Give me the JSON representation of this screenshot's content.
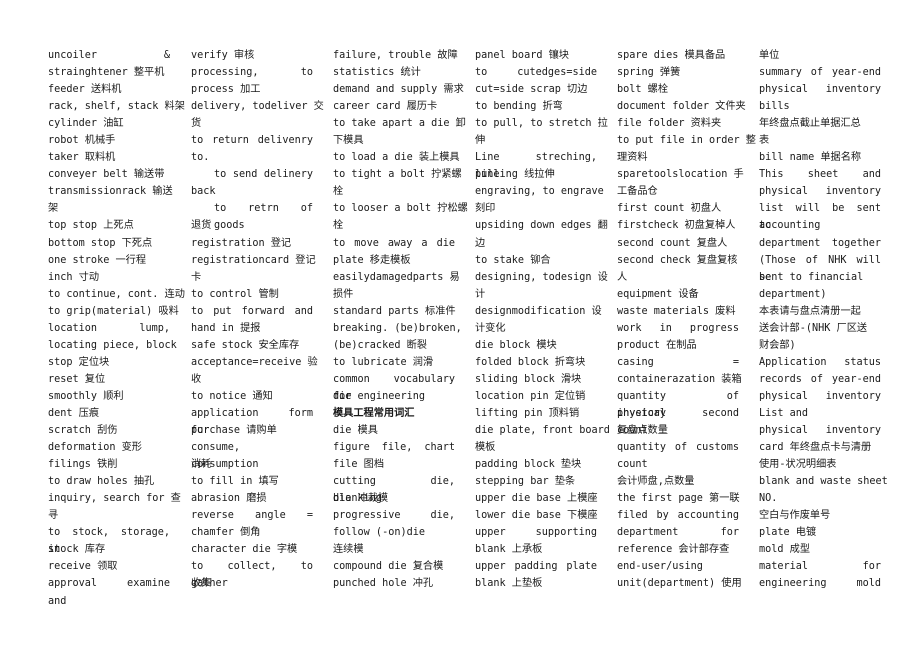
{
  "document": {
    "columns": [
      [
        {
          "t": "uncoiler &",
          "j": 1
        },
        {
          "t": "strainghtener 整平机"
        },
        {
          "t": "feeder 送料机"
        },
        {
          "t": "rack, shelf, stack 料架"
        },
        {
          "t": "cylinder 油缸"
        },
        {
          "t": "robot 机械手"
        },
        {
          "t": "taker 取料机"
        },
        {
          "t": "conveyer belt 输送带"
        },
        {
          "t": "transmissionrack 输送"
        },
        {
          "t": "架"
        },
        {
          "t": "top stop 上死点"
        },
        {
          "t": "bottom stop 下死点"
        },
        {
          "t": "one stroke 一行程"
        },
        {
          "t": "inch 寸动"
        },
        {
          "t": "to continue, cont. 连动"
        },
        {
          "t": "to grip(material) 吸料"
        },
        {
          "t": "location lump,",
          "j": 1
        },
        {
          "t": "locating piece, block"
        },
        {
          "t": "stop 定位块"
        },
        {
          "t": "reset 复位"
        },
        {
          "t": "smoothly 顺利"
        },
        {
          "t": "dent 压痕"
        },
        {
          "t": "scratch 刮伤"
        },
        {
          "t": "deformation 变形"
        },
        {
          "t": "filings 铁削"
        },
        {
          "t": "to draw holes 抽孔"
        },
        {
          "t": "inquiry, search for 查"
        },
        {
          "t": "寻"
        },
        {
          "t": "to stock, storage, in",
          "j": 1
        },
        {
          "t": "stock 库存"
        },
        {
          "t": "receive 领取"
        },
        {
          "t": "approval examine and",
          "j": 1
        }
      ],
      [
        {
          "t": "verify 审核"
        },
        {
          "t": "processing, to",
          "j": 1
        },
        {
          "t": "process 加工"
        },
        {
          "t": "delivery, todeliver 交"
        },
        {
          "t": "货"
        },
        {
          "t": "to return delivenry",
          "j": 1
        },
        {
          "t": "to."
        },
        {
          "t": "to send delinery",
          "j": 1,
          "ind": 1
        },
        {
          "t": "back"
        },
        {
          "t": "to retrn of goods",
          "j": 1,
          "ind": 1
        },
        {
          "t": "退货"
        },
        {
          "t": "registration 登记"
        },
        {
          "t": "registrationcard 登记"
        },
        {
          "t": "卡"
        },
        {
          "t": "to control 管制"
        },
        {
          "t": "to put forward and",
          "j": 1
        },
        {
          "t": "hand in 提报"
        },
        {
          "t": "safe stock 安全库存"
        },
        {
          "t": "acceptance=receive 验"
        },
        {
          "t": "收"
        },
        {
          "t": "to notice 通知"
        },
        {
          "t": "application form for",
          "j": 1
        },
        {
          "t": "purchase 请购单"
        },
        {
          "t": "consume, consumption",
          "j": 1
        },
        {
          "t": "消耗"
        },
        {
          "t": "to fill in 填写"
        },
        {
          "t": "abrasion 磨损"
        },
        {
          "t": "reverse angle =",
          "j": 1
        },
        {
          "t": "chamfer 倒角"
        },
        {
          "t": "character die 字模"
        },
        {
          "t": "to collect, to gather",
          "j": 1
        },
        {
          "t": "收集"
        }
      ],
      [
        {
          "t": "failure, trouble 故障"
        },
        {
          "t": "statistics 统计"
        },
        {
          "t": "demand and supply 需求"
        },
        {
          "t": "career card 履历卡"
        },
        {
          "t": "to take apart a die 卸"
        },
        {
          "t": "下模具"
        },
        {
          "t": "to load a die 装上模具"
        },
        {
          "t": "to tight a bolt 拧紧螺"
        },
        {
          "t": "栓"
        },
        {
          "t": "to looser a bolt 拧松螺"
        },
        {
          "t": "栓"
        },
        {
          "t": "to move away a die",
          "j": 1
        },
        {
          "t": "plate 移走模板"
        },
        {
          "t": "easilydamagedparts 易"
        },
        {
          "t": "损件"
        },
        {
          "t": "standard parts 标准件"
        },
        {
          "t": "breaking. (be)broken,"
        },
        {
          "t": "(be)cracked 断裂"
        },
        {
          "t": "to lubricate 润滑"
        },
        {
          "t": "common vocabulary for",
          "j": 1
        },
        {
          "t": "die engineering"
        },
        {
          "t": "模具工程常用词汇",
          "b": 1
        },
        {
          "t": "die 模具"
        },
        {
          "t": "figure file, chart",
          "j": 1
        },
        {
          "t": "file 图档"
        },
        {
          "t": "cutting die, blanking",
          "j": 1
        },
        {
          "t": "die 冲裁模"
        },
        {
          "t": "progressive die,",
          "j": 1
        },
        {
          "t": "follow (-on)die"
        },
        {
          "t": "连续模"
        },
        {
          "t": "compound die 复合模"
        },
        {
          "t": "punched hole 冲孔"
        }
      ],
      [
        {
          "t": "panel board 镶块"
        },
        {
          "t": "to cutedges=side",
          "j": 1
        },
        {
          "t": "cut=side scrap 切边"
        },
        {
          "t": "to bending 折弯"
        },
        {
          "t": "to pull, to stretch 拉"
        },
        {
          "t": "伸"
        },
        {
          "t": "Line streching, line",
          "j": 1
        },
        {
          "t": "pulling 线拉伸"
        },
        {
          "t": "engraving, to engrave"
        },
        {
          "t": "刻印"
        },
        {
          "t": "upsiding down edges 翻"
        },
        {
          "t": "边"
        },
        {
          "t": "to stake 铆合"
        },
        {
          "t": "designing, todesign 设"
        },
        {
          "t": "计"
        },
        {
          "t": "designmodification 设"
        },
        {
          "t": "计变化"
        },
        {
          "t": "die block 模块"
        },
        {
          "t": "folded block 折弯块"
        },
        {
          "t": "sliding block 滑块"
        },
        {
          "t": "location pin 定位销"
        },
        {
          "t": "lifting pin 顶料销"
        },
        {
          "t": "die plate, front board"
        },
        {
          "t": "模板"
        },
        {
          "t": "padding block 垫块"
        },
        {
          "t": "stepping bar 垫条"
        },
        {
          "t": "upper die base 上模座"
        },
        {
          "t": "lower die base 下模座"
        },
        {
          "t": "upper supporting",
          "j": 1
        },
        {
          "t": "blank 上承板"
        },
        {
          "t": "upper padding plate",
          "j": 1
        },
        {
          "t": "blank 上垫板"
        }
      ],
      [
        {
          "t": "spare dies 模具备品"
        },
        {
          "t": "spring 弹簧"
        },
        {
          "t": "bolt 螺栓"
        },
        {
          "t": "document folder 文件夹"
        },
        {
          "t": "file folder 资料夹"
        },
        {
          "t": "to put file in order 整"
        },
        {
          "t": "理资料"
        },
        {
          "t": "sparetoolslocation 手"
        },
        {
          "t": "工备品仓"
        },
        {
          "t": "first count 初盘人"
        },
        {
          "t": "firstcheck 初盘复棹人"
        },
        {
          "t": "second count 复盘人"
        },
        {
          "t": "second check 复盘复核"
        },
        {
          "t": "人"
        },
        {
          "t": "equipment 设备"
        },
        {
          "t": "waste materials 废料"
        },
        {
          "t": "work in progress",
          "j": 1
        },
        {
          "t": "product 在制品"
        },
        {
          "t": "casing =",
          "j": 1
        },
        {
          "t": "containerazation 装箱"
        },
        {
          "t": "quantity of physical",
          "j": 1
        },
        {
          "t": "invetory second count",
          "j": 1
        },
        {
          "t": "复盘点数量"
        },
        {
          "t": "quantity of customs",
          "j": 1
        },
        {
          "t": "count"
        },
        {
          "t": "会计师盘,点数量"
        },
        {
          "t": "the first page 第一联"
        },
        {
          "t": "filed by accounting",
          "j": 1
        },
        {
          "t": "department for",
          "j": 1
        },
        {
          "t": "reference 会计部存查"
        },
        {
          "t": "end-user/using"
        },
        {
          "t": "unit(department) 使用"
        }
      ],
      [
        {
          "t": "单位"
        },
        {
          "t": "summary of year-end",
          "j": 1
        },
        {
          "t": "physical inventory",
          "j": 1
        },
        {
          "t": "bills"
        },
        {
          "t": "年终盘点截止单据汇总"
        },
        {
          "t": "表"
        },
        {
          "t": "bill name 单据名称"
        },
        {
          "t": "This sheet and",
          "j": 1
        },
        {
          "t": "physical inventory",
          "j": 1
        },
        {
          "t": "list will be sent to",
          "j": 1
        },
        {
          "t": "accounting"
        },
        {
          "t": "department together",
          "j": 1
        },
        {
          "t": "(Those of NHK will be",
          "j": 1
        },
        {
          "t": "sent to financial"
        },
        {
          "t": "department)"
        },
        {
          "t": "本表请与盘点清册一起"
        },
        {
          "t": "送会计部-(NHK 厂区送"
        },
        {
          "t": "财会部)"
        },
        {
          "t": "Application status",
          "j": 1
        },
        {
          "t": "records of year-end",
          "j": 1
        },
        {
          "t": "physical inventory",
          "j": 1
        },
        {
          "t": "List and"
        },
        {
          "t": "physical inventory",
          "j": 1
        },
        {
          "t": "card 年终盘点卡与清册"
        },
        {
          "t": "使用-状况明细表"
        },
        {
          "t": "blank and waste sheet"
        },
        {
          "t": "NO."
        },
        {
          "t": "空白与作废单号"
        },
        {
          "t": "plate 电镀"
        },
        {
          "t": "mold 成型"
        },
        {
          "t": "material for",
          "j": 1
        },
        {
          "t": "engineering mold",
          "j": 1
        }
      ]
    ]
  }
}
